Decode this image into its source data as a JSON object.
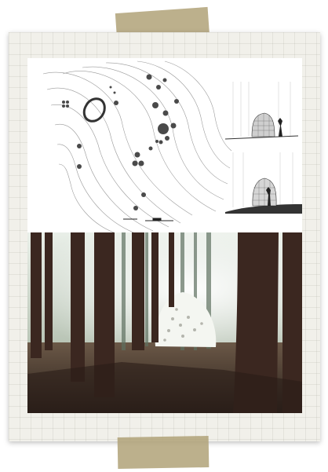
{
  "scrapbook": {
    "card": "paper-grid-card",
    "tape_color": "#b0a278",
    "paper_color": "#f1f0ea",
    "images": [
      {
        "name": "site-plan-and-sections",
        "kind": "architectural-drawing"
      },
      {
        "name": "forest-pavilion-photo",
        "kind": "photograph"
      }
    ]
  }
}
